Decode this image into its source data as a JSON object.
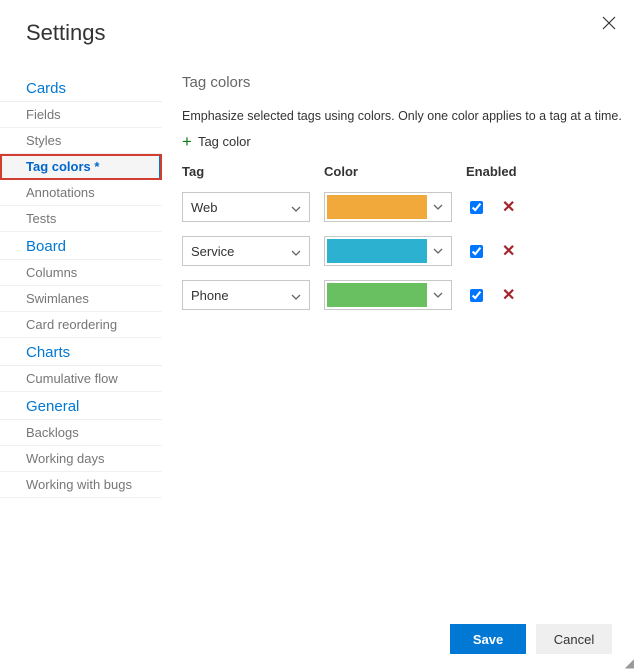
{
  "header": {
    "title": "Settings"
  },
  "sidebar": {
    "sections": [
      {
        "title": "Cards",
        "items": [
          "Fields",
          "Styles",
          "Tag colors *",
          "Annotations",
          "Tests"
        ],
        "activeIndex": 2
      },
      {
        "title": "Board",
        "items": [
          "Columns",
          "Swimlanes",
          "Card reordering"
        ]
      },
      {
        "title": "Charts",
        "items": [
          "Cumulative flow"
        ]
      },
      {
        "title": "General",
        "items": [
          "Backlogs",
          "Working days",
          "Working with bugs"
        ]
      }
    ]
  },
  "main": {
    "title": "Tag colors",
    "description": "Emphasize selected tags using colors. Only one color applies to a tag at a time.",
    "addLabel": "Tag color",
    "columns": {
      "tag": "Tag",
      "color": "Color",
      "enabled": "Enabled"
    },
    "rows": [
      {
        "tag": "Web",
        "color": "#f2a93b",
        "enabled": true
      },
      {
        "tag": "Service",
        "color": "#2cb1d0",
        "enabled": true
      },
      {
        "tag": "Phone",
        "color": "#68c060",
        "enabled": true
      }
    ]
  },
  "footer": {
    "save": "Save",
    "cancel": "Cancel"
  }
}
